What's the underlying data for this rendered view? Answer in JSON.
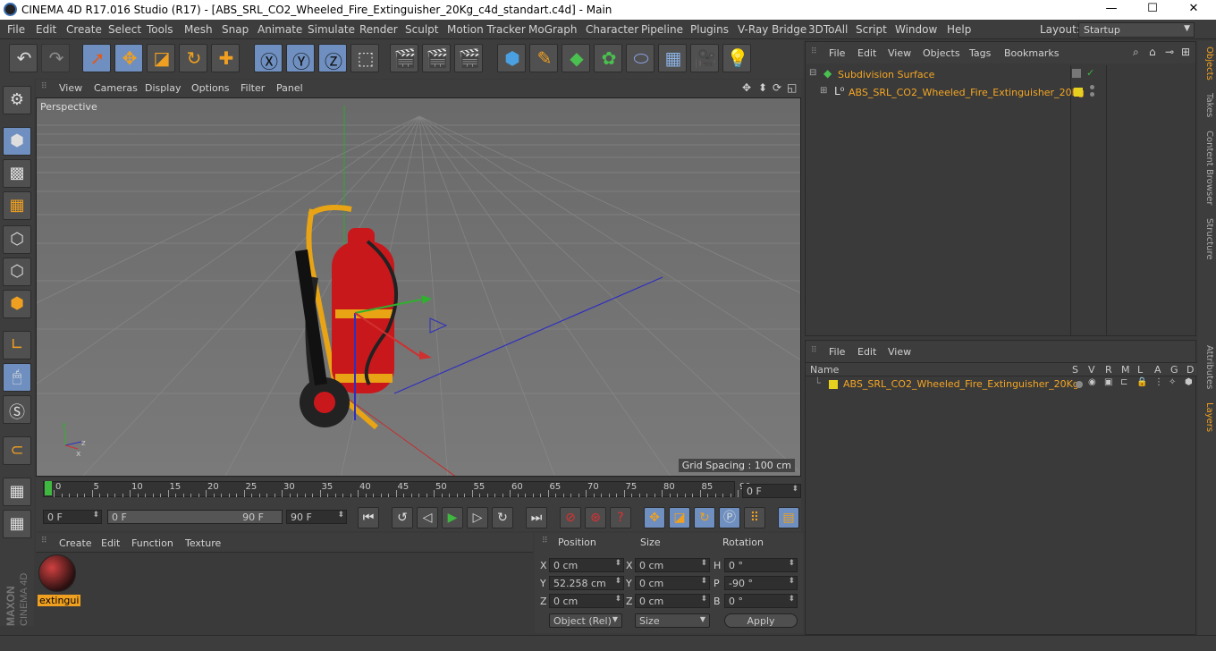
{
  "window": {
    "title": "CINEMA 4D R17.016 Studio (R17) - [ABS_SRL_CO2_Wheeled_Fire_Extinguisher_20Kg_c4d_standart.c4d] - Main",
    "minimize": "—",
    "maximize": "☐",
    "close": "✕"
  },
  "menubar": {
    "items": [
      "File",
      "Edit",
      "Create",
      "Select",
      "Tools",
      "Mesh",
      "Snap",
      "Animate",
      "Simulate",
      "Render",
      "Sculpt",
      "Motion Tracker",
      "MoGraph",
      "Character",
      "Pipeline",
      "Plugins",
      "V-Ray Bridge",
      "3DToAll",
      "Script",
      "Window",
      "Help"
    ],
    "layout_label": "Layout:",
    "layout_value": "Startup"
  },
  "viewport": {
    "menu": [
      "View",
      "Cameras",
      "Display",
      "Options",
      "Filter",
      "Panel"
    ],
    "label": "Perspective",
    "grid_spacing": "Grid Spacing : 100 cm"
  },
  "timeline": {
    "ticks": [
      "0",
      "5",
      "10",
      "15",
      "20",
      "25",
      "30",
      "35",
      "40",
      "45",
      "50",
      "55",
      "60",
      "65",
      "70",
      "75",
      "80",
      "85",
      "90"
    ],
    "end_field": "0 F"
  },
  "transport": {
    "current": "0 F",
    "range_start": "0 F",
    "range_end": "90 F",
    "max": "90 F"
  },
  "material_manager": {
    "menu": [
      "Create",
      "Edit",
      "Function",
      "Texture"
    ],
    "material_name": "extingui"
  },
  "coordinates": {
    "headers": [
      "Position",
      "Size",
      "Rotation"
    ],
    "rows": [
      {
        "axis": "X",
        "pos": "0 cm",
        "size_axis": "X",
        "size": "0 cm",
        "rot_axis": "H",
        "rot": "0 °"
      },
      {
        "axis": "Y",
        "pos": "52.258 cm",
        "size_axis": "Y",
        "size": "0 cm",
        "rot_axis": "P",
        "rot": "-90 °"
      },
      {
        "axis": "Z",
        "pos": "0 cm",
        "size_axis": "Z",
        "size": "0 cm",
        "rot_axis": "B",
        "rot": "0 °"
      }
    ],
    "mode_select": "Object (Rel)",
    "size_select": "Size",
    "apply": "Apply"
  },
  "objects_panel": {
    "menu": [
      "File",
      "Edit",
      "View",
      "Objects",
      "Tags",
      "Bookmarks"
    ],
    "items": [
      {
        "name": "Subdivision Surface"
      },
      {
        "name": "ABS_SRL_CO2_Wheeled_Fire_Extinguisher_20Kg"
      }
    ]
  },
  "layers_panel": {
    "menu": [
      "File",
      "Edit",
      "View"
    ],
    "name_header": "Name",
    "col_headers": [
      "S",
      "V",
      "R",
      "M",
      "L",
      "A",
      "G",
      "D"
    ],
    "layer_name": "ABS_SRL_CO2_Wheeled_Fire_Extinguisher_20Kg"
  },
  "right_tabs": [
    "Objects",
    "Takes",
    "Content Browser",
    "Structure",
    "Attributes",
    "Layers"
  ],
  "colors": {
    "accent_orange": "#f5a623",
    "highlight_blue": "#6e8fc0",
    "layer_yellow": "#e6d21e"
  }
}
